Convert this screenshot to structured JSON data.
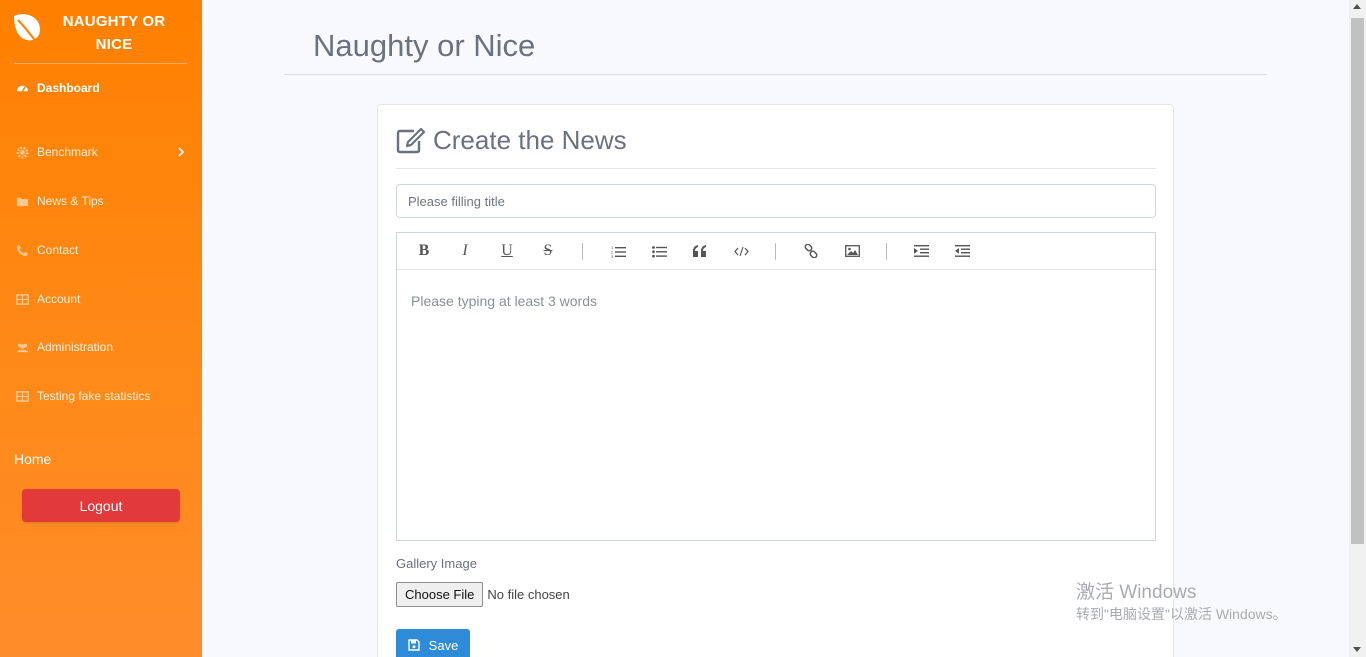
{
  "sidebar": {
    "brand": "NAUGHTY OR NICE",
    "brand_line1": "NAUGHTY OR",
    "brand_line2": "NICE",
    "brand_icon": "leaf-icon",
    "items": [
      {
        "label": "Dashboard",
        "icon": "tachometer-icon",
        "active": true
      },
      {
        "label": "Benchmark",
        "icon": "gear-icon",
        "has_submenu": true
      },
      {
        "label": "News & Tips",
        "icon": "folder-icon"
      },
      {
        "label": "Contact",
        "icon": "phone-icon"
      },
      {
        "label": "Account",
        "icon": "table-icon"
      },
      {
        "label": "Administration",
        "icon": "users-icon"
      },
      {
        "label": "Testing fake statistics",
        "icon": "table-icon"
      }
    ],
    "home_label": "Home",
    "logout_label": "Logout"
  },
  "page": {
    "title": "Naughty or Nice"
  },
  "card": {
    "title": "Create the News",
    "title_icon": "edit-icon",
    "title_input_placeholder": "Please filling title",
    "editor": {
      "toolbar": [
        "bold",
        "italic",
        "underline",
        "strikethrough",
        "ordered-list",
        "bullet-list",
        "blockquote",
        "code",
        "link",
        "image",
        "indent",
        "outdent"
      ],
      "placeholder": "Please typing at least 3 words"
    },
    "gallery_label": "Gallery Image",
    "choose_file_label": "Choose File",
    "file_status": "No file chosen",
    "save_label": "Save"
  },
  "watermark": {
    "title": "激活 Windows",
    "subtitle": "转到\"电脑设置\"以激活 Windows。"
  },
  "colors": {
    "sidebar": "#ff8000",
    "logout": "#e23a3a",
    "save": "#2e8bd8"
  }
}
